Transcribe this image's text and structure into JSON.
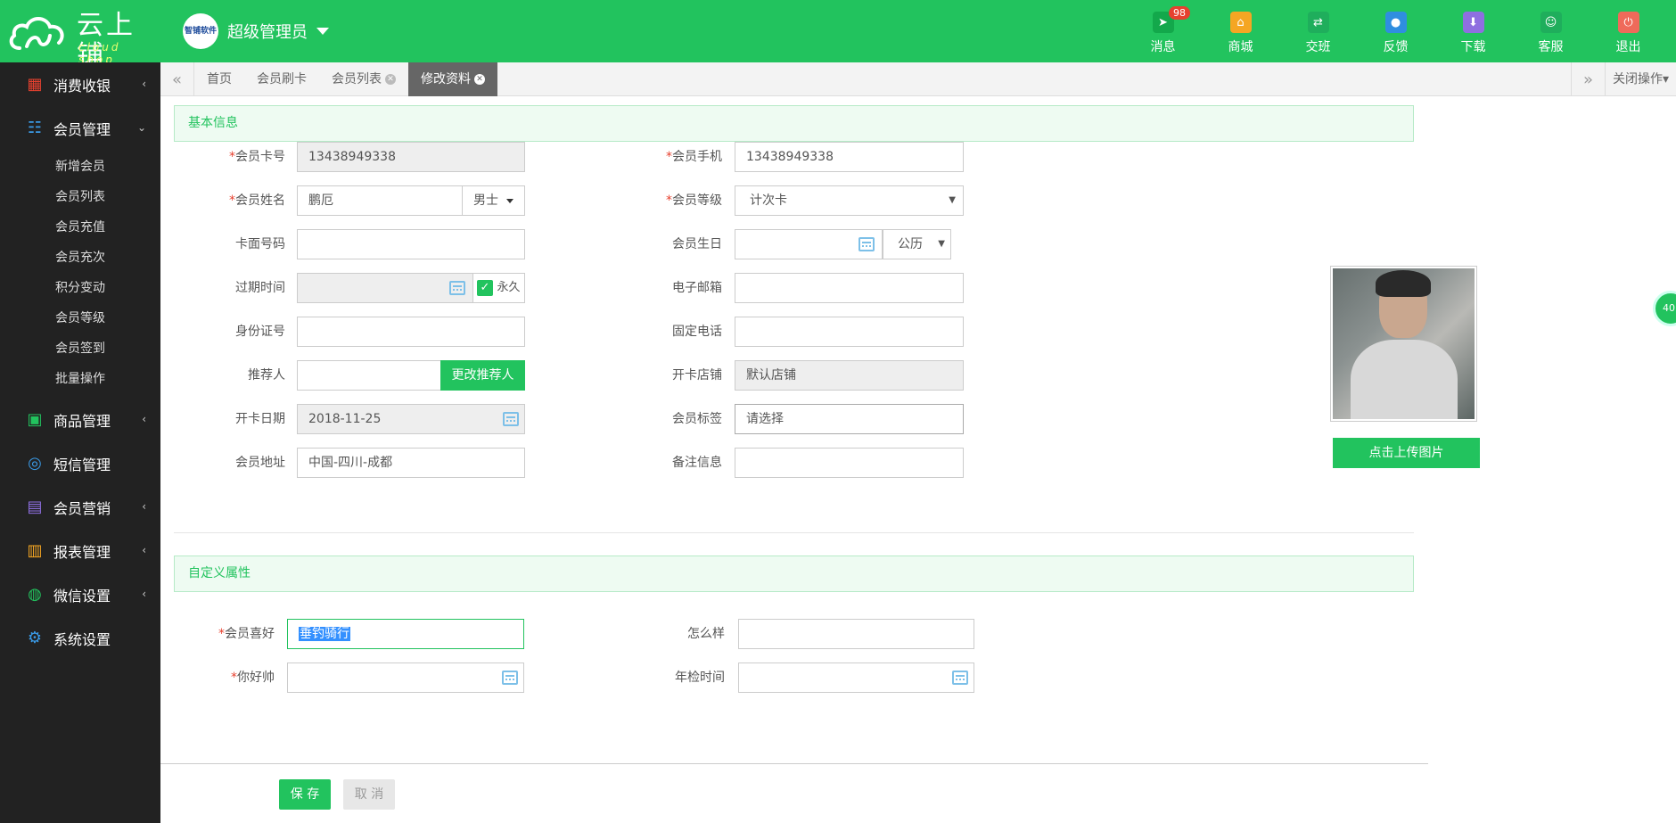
{
  "app": {
    "brand": "云上铺",
    "brand_sub": "cloud shop",
    "avatar_text": "智铺软件",
    "user": "超级管理员",
    "accent": "#22c35e"
  },
  "topnav": [
    {
      "label": "消息",
      "icon": "paper-plane-icon",
      "badge": "98",
      "color": "#13a84b"
    },
    {
      "label": "商城",
      "icon": "shop-icon",
      "color": "#f5a623"
    },
    {
      "label": "交班",
      "icon": "swap-icon",
      "color": "#1fae5c"
    },
    {
      "label": "反馈",
      "icon": "chat-icon",
      "color": "#2f8ee0"
    },
    {
      "label": "下载",
      "icon": "download-icon",
      "color": "#8e6fe0"
    },
    {
      "label": "客服",
      "icon": "service-icon",
      "color": "#1fae5c"
    },
    {
      "label": "退出",
      "icon": "power-icon",
      "color": "#ef6a5a"
    }
  ],
  "sidebar": {
    "items": [
      {
        "label": "消费收银",
        "icon": "cashier-icon",
        "color": "#e7412f",
        "chevron": "‹"
      },
      {
        "label": "会员管理",
        "icon": "members-icon",
        "color": "#3a9ae6",
        "chevron": "⌄"
      },
      {
        "label": "商品管理",
        "icon": "goods-icon",
        "color": "#22c35e",
        "chevron": "‹"
      },
      {
        "label": "短信管理",
        "icon": "sms-icon",
        "color": "#3a9ae6",
        "chevron": ""
      },
      {
        "label": "会员营销",
        "icon": "gift-icon",
        "color": "#8e6fe0",
        "chevron": "‹"
      },
      {
        "label": "报表管理",
        "icon": "report-icon",
        "color": "#f5a623",
        "chevron": "‹"
      },
      {
        "label": "微信设置",
        "icon": "wechat-icon",
        "color": "#22c35e",
        "chevron": "‹"
      },
      {
        "label": "系统设置",
        "icon": "settings-icon",
        "color": "#3a9ae6",
        "chevron": ""
      }
    ],
    "subitems": [
      "新增会员",
      "会员列表",
      "会员充值",
      "会员充次",
      "积分变动",
      "会员等级",
      "会员签到",
      "批量操作"
    ]
  },
  "tabs": [
    {
      "label": "首页",
      "closable": false
    },
    {
      "label": "会员刷卡",
      "closable": false
    },
    {
      "label": "会员列表",
      "closable": true
    },
    {
      "label": "修改资料",
      "closable": true,
      "active": true
    }
  ],
  "tabbar": {
    "close_ops": "关闭操作"
  },
  "basic": {
    "title": "基本信息",
    "card_no_label": "会员卡号",
    "card_no": "13438949338",
    "phone_label": "会员手机",
    "phone": "13438949338",
    "name_label": "会员姓名",
    "name": "鹏厄",
    "gender": "男士",
    "level_label": "会员等级",
    "level": "计次卡",
    "face_no_label": "卡面号码",
    "face_no": "",
    "birthday_label": "会员生日",
    "birthday": "",
    "calendar_type": "公历",
    "expire_label": "过期时间",
    "expire": "",
    "permanent": "永久",
    "email_label": "电子邮箱",
    "email": "",
    "id_label": "身份证号",
    "id_no": "",
    "tel_label": "固定电话",
    "tel": "",
    "referrer_label": "推荐人",
    "referrer": "",
    "change_referrer": "更改推荐人",
    "store_label": "开卡店铺",
    "store": "默认店铺",
    "open_date_label": "开卡日期",
    "open_date": "2018-11-25",
    "tag_label": "会员标签",
    "tag_placeholder": "请选择",
    "address_label": "会员地址",
    "address": "中国-四川-成都",
    "remark_label": "备注信息",
    "remark": "",
    "upload": "点击上传图片"
  },
  "custom": {
    "title": "自定义属性",
    "hobby_label": "会员喜好",
    "hobby": "垂钓骑行",
    "how_label": "怎么样",
    "how": "",
    "hello_label": "你好帅",
    "hello": "",
    "inspect_label": "年检时间",
    "inspect": ""
  },
  "footer": {
    "save": "保 存",
    "cancel": "取 消"
  },
  "float_ball": "40"
}
